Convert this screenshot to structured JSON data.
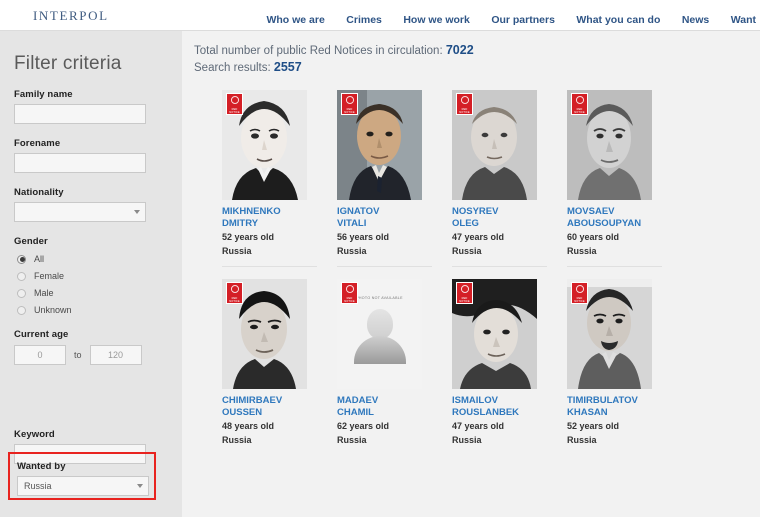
{
  "header": {
    "brand": "INTERPOL",
    "nav": [
      {
        "label": "Who we are"
      },
      {
        "label": "Crimes"
      },
      {
        "label": "How we work"
      },
      {
        "label": "Our partners"
      },
      {
        "label": "What you can do"
      },
      {
        "label": "News"
      },
      {
        "label": "Want"
      }
    ]
  },
  "sidebar": {
    "title": "Filter criteria",
    "family_name": {
      "label": "Family name",
      "value": "",
      "placeholder": ""
    },
    "forename": {
      "label": "Forename",
      "value": "",
      "placeholder": ""
    },
    "nationality": {
      "label": "Nationality",
      "value": ""
    },
    "gender": {
      "label": "Gender",
      "options": [
        {
          "label": "All",
          "selected": true
        },
        {
          "label": "Female",
          "selected": false
        },
        {
          "label": "Male",
          "selected": false
        },
        {
          "label": "Unknown",
          "selected": false
        }
      ]
    },
    "current_age": {
      "label": "Current age",
      "from": "0",
      "to_label": "to",
      "to": "120"
    },
    "wanted_by": {
      "label": "Wanted by",
      "value": "Russia",
      "highlight_color": "#e8231f"
    },
    "keyword": {
      "label": "Keyword",
      "value": ""
    }
  },
  "results": {
    "total_label": "Total number of public Red Notices in circulation:",
    "total_value": "7022",
    "search_label": "Search results:",
    "search_value": "2557",
    "cards": [
      {
        "name_line1": "MIKHNENKO",
        "name_line2": "DMITRY",
        "age": "52 years old",
        "country": "Russia",
        "photo": "portrait",
        "badge": "red-notice-badge"
      },
      {
        "name_line1": "IGNATOV",
        "name_line2": "VITALI",
        "age": "56 years old",
        "country": "Russia",
        "photo": "portrait",
        "badge": "red-notice-badge"
      },
      {
        "name_line1": "NOSYREV",
        "name_line2": "OLEG",
        "age": "47 years old",
        "country": "Russia",
        "photo": "portrait",
        "badge": "red-notice-badge"
      },
      {
        "name_line1": "MOVSAEV",
        "name_line2": "ABOUSOUPYAN",
        "age": "60 years old",
        "country": "Russia",
        "photo": "portrait",
        "badge": "red-notice-badge"
      },
      {
        "name_line1": "CHIMIRBAEV",
        "name_line2": "OUSSEN",
        "age": "48 years old",
        "country": "Russia",
        "photo": "portrait",
        "badge": "red-notice-badge"
      },
      {
        "name_line1": "MADAEV",
        "name_line2": "CHAMIL",
        "age": "62 years old",
        "country": "Russia",
        "photo": "not-available",
        "photo_placeholder_text": "PHOTO NOT AVAILABLE",
        "badge": "red-notice-badge"
      },
      {
        "name_line1": "ISMAILOV",
        "name_line2": "ROUSLANBEK",
        "age": "47 years old",
        "country": "Russia",
        "photo": "portrait",
        "badge": "red-notice-badge"
      },
      {
        "name_line1": "TIMIRBULATOV",
        "name_line2": "KHASAN",
        "age": "52 years old",
        "country": "Russia",
        "photo": "portrait",
        "badge": "red-notice-badge"
      }
    ]
  },
  "badge_text": "RED NOTICE",
  "colors": {
    "brand_blue": "#2f5586",
    "link_blue": "#2f78bd",
    "notice_red": "#d41f26",
    "highlight_red": "#e8231f",
    "sidebar_bg": "#e5e5e5",
    "main_bg": "#f2f2f2"
  }
}
